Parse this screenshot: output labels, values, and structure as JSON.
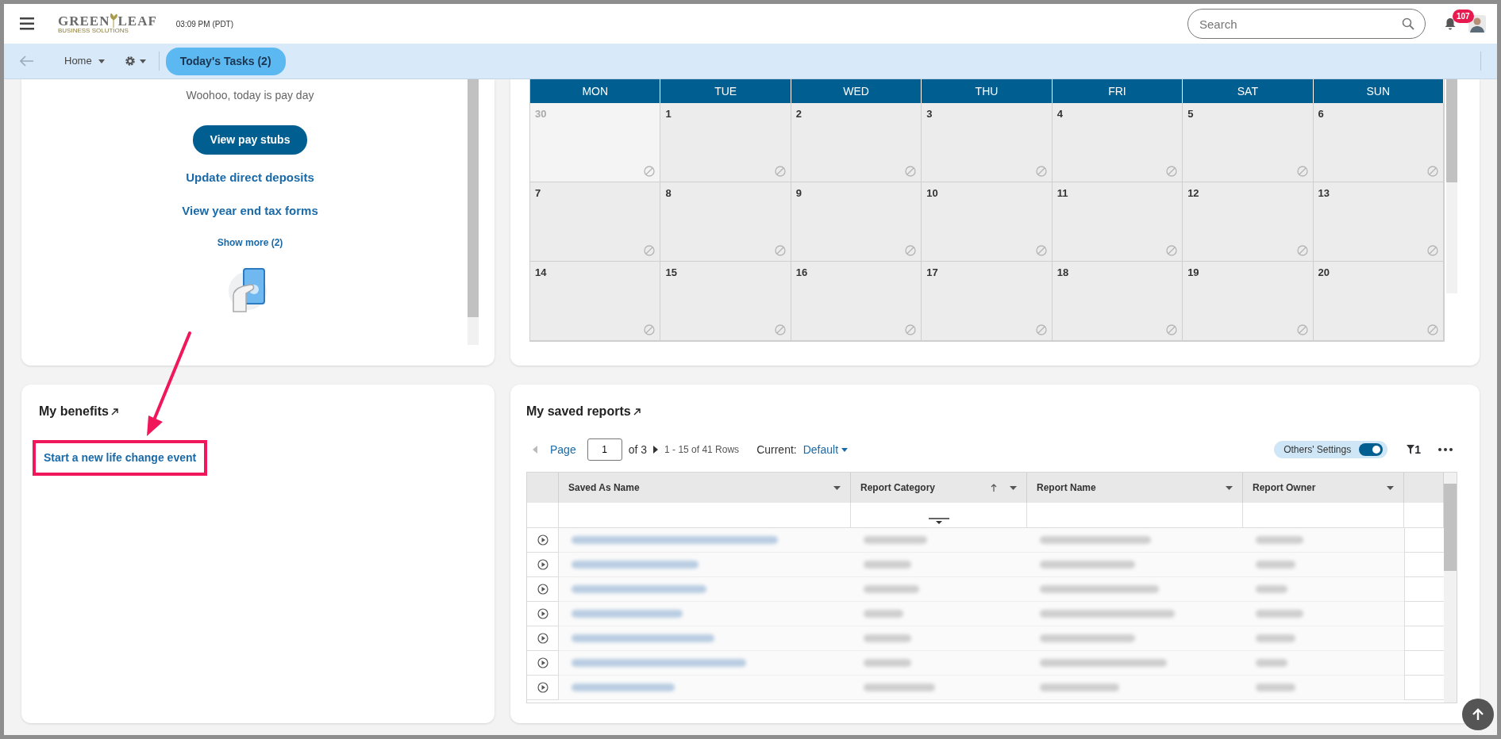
{
  "header": {
    "logo": {
      "word1": "GREEN",
      "word2": "LEAF",
      "tagline": "BUSINESS SOLUTIONS"
    },
    "time": "03:09 PM (PDT)",
    "search": {
      "placeholder": "Search"
    },
    "notifications": "107"
  },
  "subnav": {
    "home": "Home",
    "tasks": "Today's Tasks (2)"
  },
  "pay_card": {
    "message": "Woohoo, today is pay day",
    "button": "View pay stubs",
    "links": [
      "Update direct deposits",
      "View year end tax forms"
    ],
    "show_more": "Show more (2)"
  },
  "calendar": {
    "days": [
      "MON",
      "TUE",
      "WED",
      "THU",
      "FRI",
      "SAT",
      "SUN"
    ],
    "weeks": [
      [
        {
          "day": "30",
          "outside": true
        },
        {
          "day": "1",
          "outside": false
        },
        {
          "day": "2",
          "outside": false
        },
        {
          "day": "3",
          "outside": false
        },
        {
          "day": "4",
          "outside": false
        },
        {
          "day": "5",
          "outside": false
        },
        {
          "day": "6",
          "outside": false
        }
      ],
      [
        {
          "day": "7",
          "outside": false
        },
        {
          "day": "8",
          "outside": false
        },
        {
          "day": "9",
          "outside": false
        },
        {
          "day": "10",
          "outside": false
        },
        {
          "day": "11",
          "outside": false
        },
        {
          "day": "12",
          "outside": false
        },
        {
          "day": "13",
          "outside": false
        }
      ],
      [
        {
          "day": "14",
          "outside": false
        },
        {
          "day": "15",
          "outside": false
        },
        {
          "day": "16",
          "outside": false
        },
        {
          "day": "17",
          "outside": false
        },
        {
          "day": "18",
          "outside": false
        },
        {
          "day": "19",
          "outside": false
        },
        {
          "day": "20",
          "outside": false
        }
      ]
    ]
  },
  "benefits": {
    "title": "My benefits",
    "link": {
      "label": "Start a new life change event",
      "highlighted": true
    }
  },
  "reports": {
    "title": "My saved reports",
    "pager": {
      "label": "Page",
      "page": "1",
      "of": "of 3",
      "rows": "1 - 15 of 41 Rows"
    },
    "current_label": "Current:",
    "current_view": "Default",
    "toggle": {
      "label": "Others' Settings",
      "on": true
    },
    "filter_count": "1",
    "columns": [
      {
        "label": "Saved As Name",
        "sorted": false
      },
      {
        "label": "Report Category",
        "sorted": true
      },
      {
        "label": "Report Name",
        "sorted": false
      },
      {
        "label": "Report Owner",
        "sorted": false
      }
    ],
    "rows": [
      {
        "kind": "redacted"
      },
      {
        "kind": "redacted"
      },
      {
        "kind": "redacted"
      },
      {
        "kind": "redacted"
      },
      {
        "kind": "redacted"
      },
      {
        "kind": "redacted"
      },
      {
        "kind": "redacted"
      }
    ]
  }
}
